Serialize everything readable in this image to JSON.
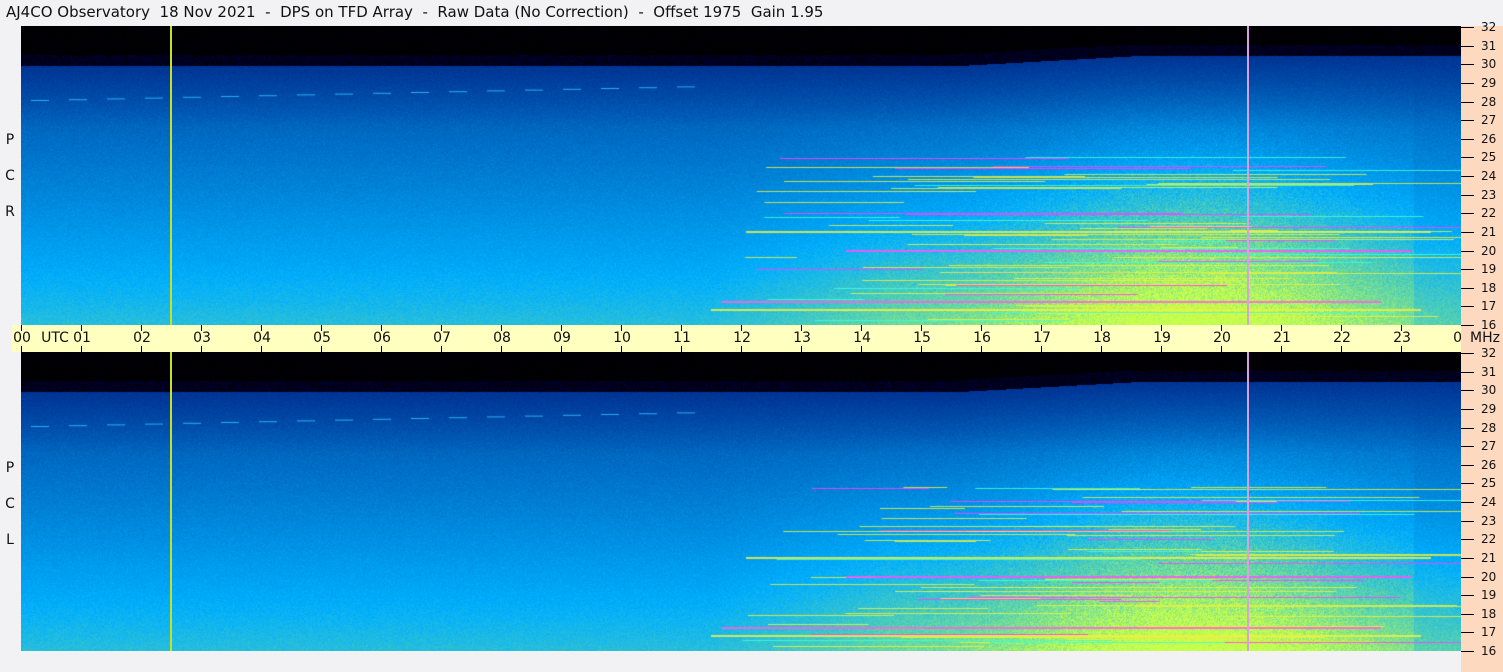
{
  "title": "AJ4CO Observatory  18 Nov 2021  -  DPS on TFD Array  -  Raw Data (No Correction)  -  Offset 1975  Gain 1.95",
  "panels": [
    {
      "id": "rcp",
      "label": [
        "R",
        "C",
        "P"
      ]
    },
    {
      "id": "lcp",
      "label": [
        "L",
        "C",
        "P"
      ]
    }
  ],
  "time_axis": {
    "unit_label": "UTC",
    "hours": [
      "00",
      "01",
      "02",
      "03",
      "04",
      "05",
      "06",
      "07",
      "08",
      "09",
      "10",
      "11",
      "12",
      "13",
      "14",
      "15",
      "16",
      "17",
      "18",
      "19",
      "20",
      "21",
      "22",
      "23",
      "00"
    ]
  },
  "freq_axis": {
    "unit_label": "MHz",
    "ticks": [
      32,
      31,
      30,
      29,
      28,
      27,
      26,
      25,
      24,
      23,
      22,
      21,
      20,
      19,
      18,
      17,
      16
    ]
  },
  "markers": [
    {
      "time_hours": 2.5,
      "color": "#c8e020"
    },
    {
      "time_hours": 20.45,
      "color": "#d8a0e0"
    }
  ],
  "colors": {
    "axis_strip": "#ffffc0",
    "freq_strip": "#fdd9c0"
  }
}
